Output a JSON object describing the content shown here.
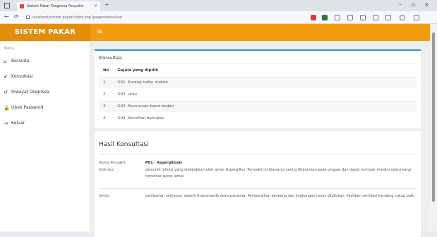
{
  "browser": {
    "tab_title": "Sistem Pakar Diagnosa Penyakit",
    "tab_close": "×",
    "new_tab": "+",
    "url": "localhost/sistem-pakar/index.php?page=konsultasi",
    "back": "←",
    "reload": "⟳",
    "minimize": "–",
    "maximize": "▫",
    "close": "×"
  },
  "header": {
    "brand": "SISTEM PAKAR",
    "menu_toggle": "≡"
  },
  "sidebar": {
    "header": "Menu",
    "items": [
      {
        "icon": "⌂",
        "label": "Beranda"
      },
      {
        "icon": "✔",
        "label": "Konsultasi"
      },
      {
        "icon": "↺",
        "label": "Riwayat Diagnosa"
      },
      {
        "icon": "🔒",
        "label": "Ubah Password"
      },
      {
        "icon": "⇥",
        "label": "Keluar"
      }
    ]
  },
  "konsultasi": {
    "title": "Konsultasi",
    "columns": [
      "No",
      "Gejala yang dipilih"
    ],
    "rows": [
      {
        "no": "1",
        "code": "G01",
        "name": "Kurang nafsu makan"
      },
      {
        "no": "2",
        "code": "G02",
        "name": "Lesu"
      },
      {
        "no": "3",
        "code": "G03",
        "name": "Penurunan berat badan"
      },
      {
        "no": "4",
        "code": "G04",
        "name": "Kesulitan bernafas"
      }
    ]
  },
  "hasil": {
    "title": "Hasil Konsultasi",
    "disease_label": "Nama Penyakit",
    "disease_value": "P01 - Aspergillosis",
    "desc_label": "Diskripsi",
    "desc_value": "penyakit infeksi yang disebabkan oleh jamur Aspergillus. Penyakit ini biasanya sering ditemukan pada unggas dan dapat menular melalui udara yang tercemar spora jamur.",
    "solusi_label": "Solusi",
    "solusi_value": "pemberian antijamur seperti Itraconazole dosis pertama. Pembersihan kandang dan lingkungan harus dilakukan. Pastikan ventilasi kandang cukup baik."
  }
}
